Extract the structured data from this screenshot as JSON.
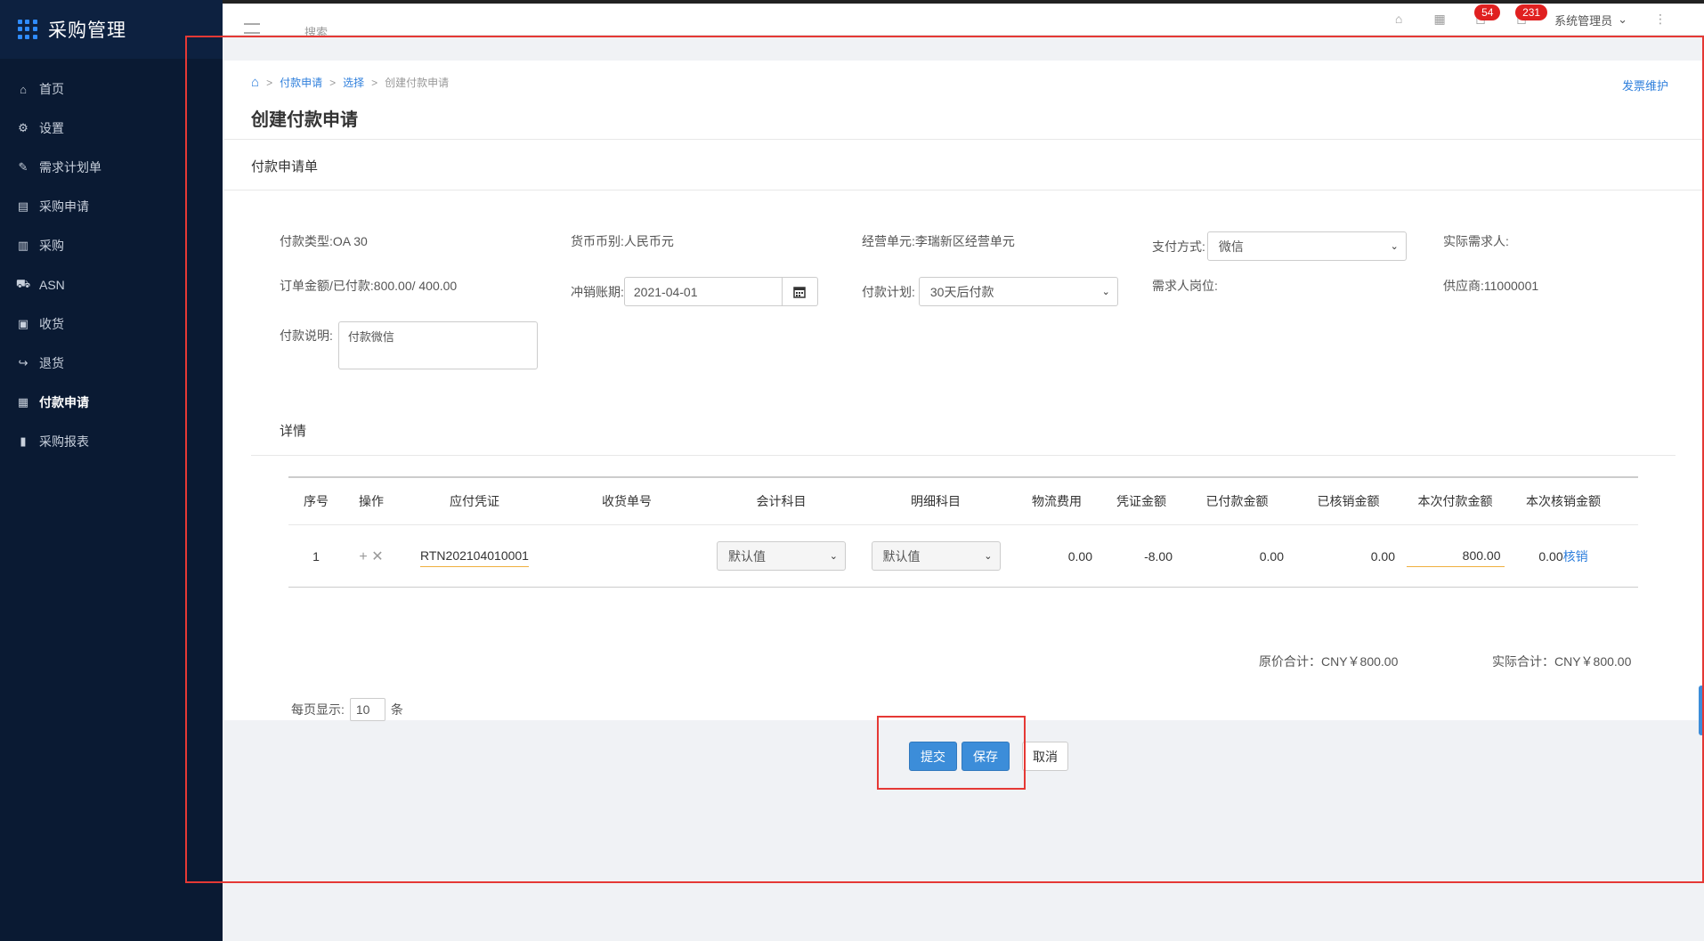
{
  "app": {
    "title": "采购管理"
  },
  "sidebar": {
    "items": [
      {
        "label": "首页",
        "icon": "home-icon"
      },
      {
        "label": "设置",
        "icon": "gear-icon"
      },
      {
        "label": "需求计划单",
        "icon": "document-edit-icon"
      },
      {
        "label": "采购申请",
        "icon": "document-list-icon"
      },
      {
        "label": "采购",
        "icon": "clipboard-icon"
      },
      {
        "label": "ASN",
        "icon": "truck-icon"
      },
      {
        "label": "收货",
        "icon": "inbox-icon"
      },
      {
        "label": "退货",
        "icon": "return-icon"
      },
      {
        "label": "付款申请",
        "icon": "payment-doc-icon",
        "active": true
      },
      {
        "label": "采购报表",
        "icon": "bar-chart-icon"
      }
    ]
  },
  "header": {
    "search_text": "搜索",
    "badge_messages": "54",
    "badge_notifications": "231",
    "user": "系统管理员"
  },
  "breadcrumb": {
    "items": [
      "付款申请",
      "选择",
      "创建付款申请"
    ]
  },
  "page": {
    "title": "创建付款申请",
    "invoice_link": "发票维护"
  },
  "form": {
    "section_title": "付款申请单",
    "payment_type_label": "付款类型:",
    "payment_type_value": "OA 30",
    "currency_label": "货币币别:",
    "currency_value": "人民币元",
    "business_unit_label": "经营单元:",
    "business_unit_value": "李瑞新区经营单元",
    "pay_method_label": "支付方式:",
    "pay_method_value": "微信",
    "actual_requester_label": "实际需求人:",
    "order_amount_label": "订单金额/已付款:",
    "order_amount_value": "800.00/ 400.00",
    "writeoff_period_label": "冲销账期:",
    "writeoff_period_value": "2021-04-01",
    "payment_plan_label": "付款计划:",
    "payment_plan_value": "30天后付款",
    "requester_position_label": "需求人岗位:",
    "supplier_label": "供应商:",
    "supplier_value": "11000001",
    "payment_note_label": "付款说明:",
    "payment_note_value": "付款微信"
  },
  "details": {
    "section_title": "详情",
    "columns": [
      "序号",
      "操作",
      "应付凭证",
      "收货单号",
      "会计科目",
      "明细科目",
      "物流费用",
      "凭证金额",
      "已付款金额",
      "已核销金额",
      "本次付款金额",
      "本次核销金额"
    ],
    "rows": [
      {
        "seq": "1",
        "voucher": "RTN202104010001",
        "receipt_no": "",
        "account": "默认值",
        "sub_account": "默认值",
        "logistics_fee": "0.00",
        "voucher_amount": "-8.00",
        "paid_amount": "0.00",
        "written_off": "0.00",
        "current_payment": "800.00",
        "current_writeoff": "0.00",
        "writeoff_link": "核销"
      }
    ],
    "original_total": "原价合计：CNY￥800.00",
    "actual_total": "实际合计：CNY￥800.00",
    "page_size_label": "每页显示:",
    "page_size_value": "10",
    "page_size_unit": "条"
  },
  "actions": {
    "submit": "提交",
    "save": "保存",
    "cancel": "取消"
  },
  "colors": {
    "sidebar_bg": "#0a1a33",
    "accent": "#3c8dd9",
    "annotation": "#e53935",
    "badge": "#e02020"
  }
}
